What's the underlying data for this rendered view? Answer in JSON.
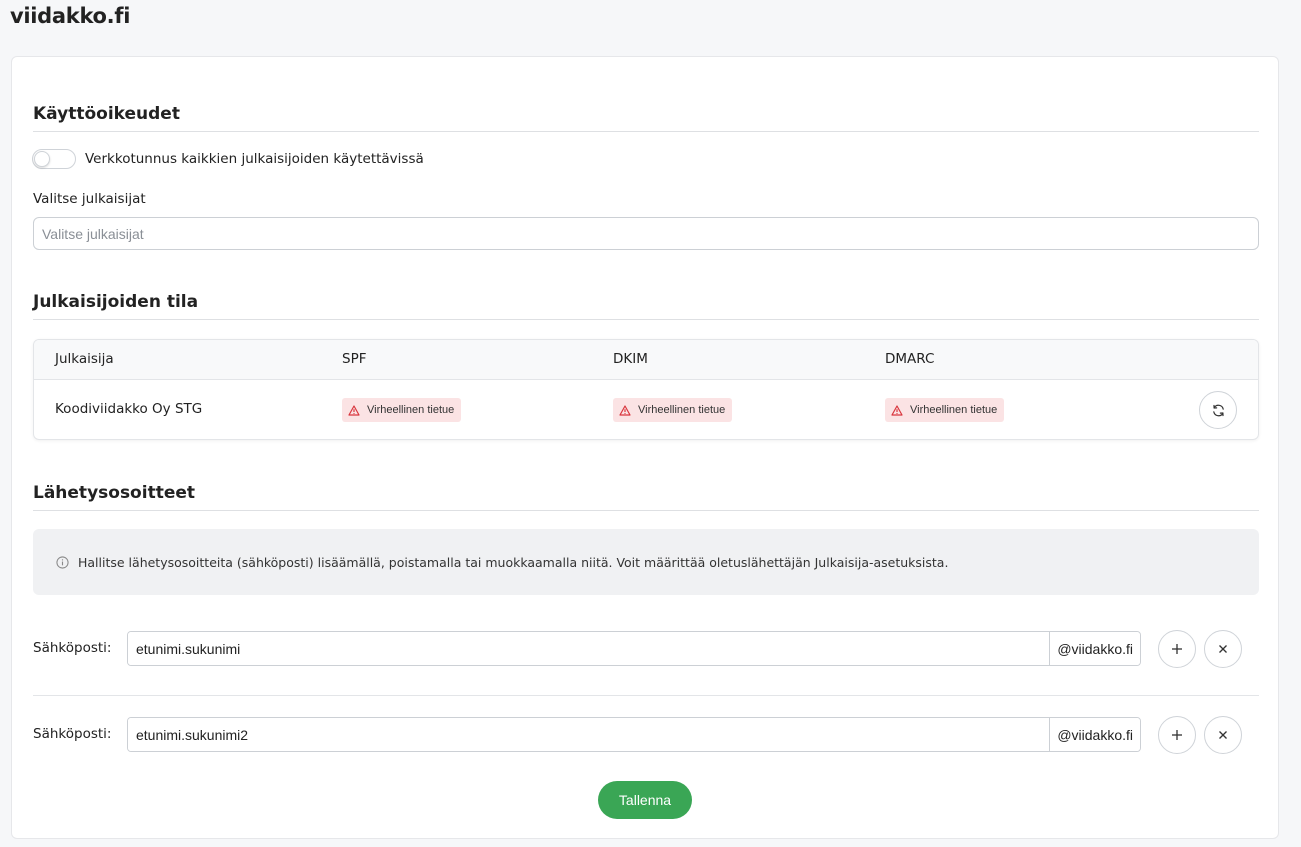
{
  "site": {
    "title": "viidakko.fi"
  },
  "permissions": {
    "title": "Käyttöoikeudet",
    "toggle_label": "Verkkotunnus kaikkien julkaisijoiden käytettävissä",
    "toggle_on": false,
    "select_label": "Valitse julkaisijat",
    "select_placeholder": "Valitse julkaisijat"
  },
  "publisher_status": {
    "title": "Julkaisijoiden tila",
    "columns": [
      "Julkaisija",
      "SPF",
      "DKIM",
      "DMARC"
    ],
    "rows": [
      {
        "publisher": "Koodiviidakko Oy STG",
        "spf": "Virheellinen tietue",
        "dkim": "Virheellinen tietue",
        "dmarc": "Virheellinen tietue"
      }
    ],
    "refresh_icon": "refresh-icon",
    "error_color": "#fbe3e4",
    "error_icon_color": "#d9363e"
  },
  "sender_addresses": {
    "title": "Lähetysosoitteet",
    "info_text": "Hallitse lähetysosoitteita (sähköposti) lisäämällä, poistamalla tai muokkaamalla niitä. Voit määrittää oletuslähettäjän Julkaisija-asetuksista.",
    "emails": [
      {
        "label": "Sähköposti:",
        "value": "etunimi.sukunimi",
        "suffix": "@viidakko.fi"
      },
      {
        "label": "Sähköposti:",
        "value": "etunimi.sukunimi2",
        "suffix": "@viidakko.fi"
      }
    ]
  },
  "actions": {
    "save_label": "Tallenna",
    "save_color": "#3aa655"
  }
}
